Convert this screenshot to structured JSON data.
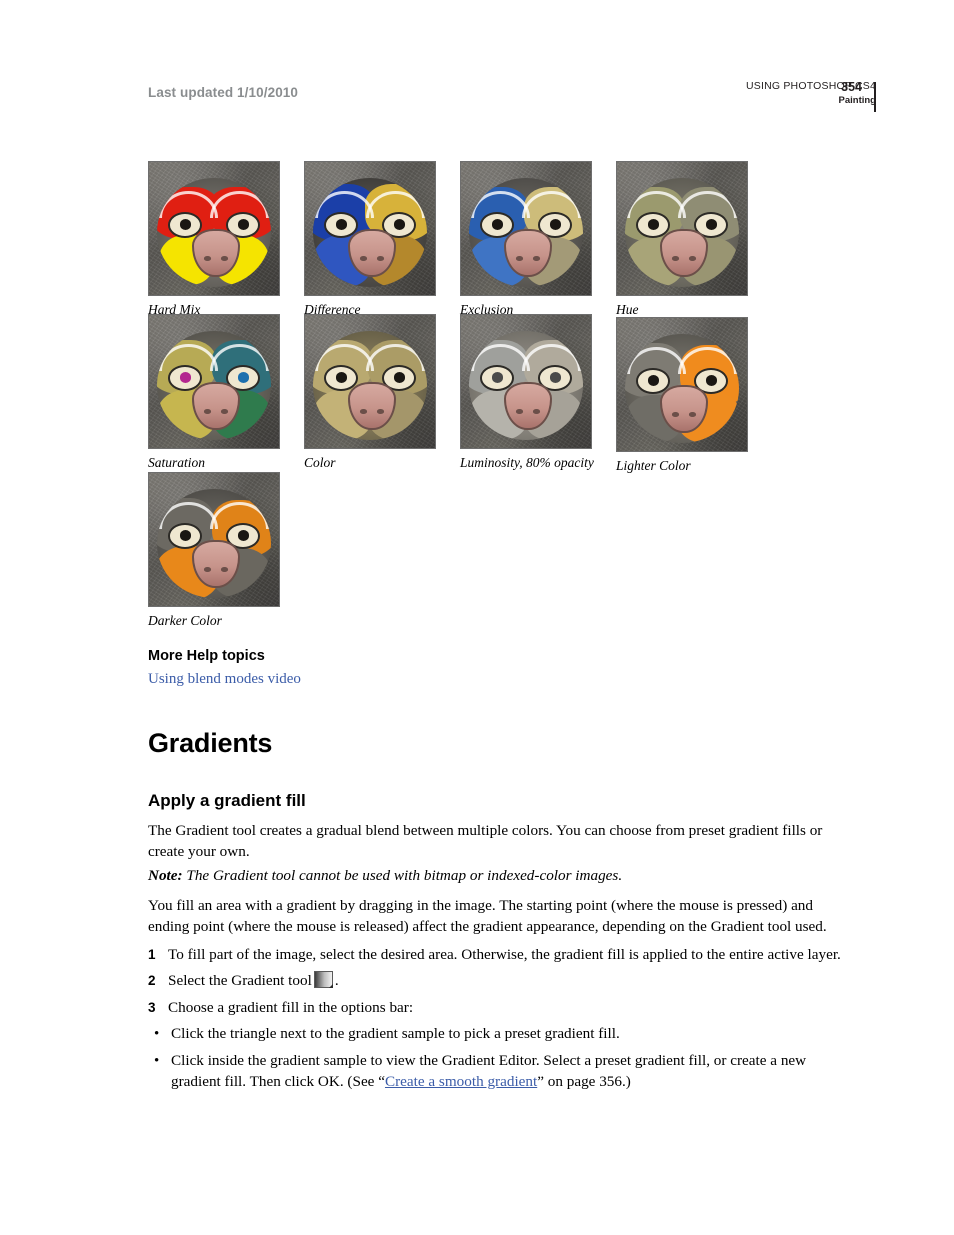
{
  "header": {
    "last_updated": "Last updated 1/10/2010",
    "doc_title": "USING PHOTOSHOP CS4",
    "section": "Painting",
    "page_number": "354"
  },
  "figures": [
    {
      "caption": "Hard Mix"
    },
    {
      "caption": "Difference"
    },
    {
      "caption": "Exclusion"
    },
    {
      "caption": "Hue"
    },
    {
      "caption": "Saturation"
    },
    {
      "caption": "Color"
    },
    {
      "caption": "Luminosity, 80% opacity"
    },
    {
      "caption": "Lighter Color"
    },
    {
      "caption": "Darker Color"
    }
  ],
  "more_help": {
    "heading": "More Help topics",
    "link": "Using blend modes video"
  },
  "gradients": {
    "h1": "Gradients",
    "h2": "Apply a gradient fill",
    "intro": "The Gradient tool creates a gradual blend between multiple colors. You can choose from preset gradient fills or create your own.",
    "note_label": "Note:",
    "note_text": "The Gradient tool cannot be used with bitmap or indexed-color images.",
    "paragraph2": "You fill an area with a gradient by dragging in the image. The starting point (where the mouse is pressed) and ending point (where the mouse is released) affect the gradient appearance, depending on the Gradient tool used.",
    "steps": [
      {
        "num": "1",
        "text": "To fill part of the image, select the desired area. Otherwise, the gradient fill is applied to the entire active layer."
      },
      {
        "num": "2",
        "text_before": "Select the Gradient tool",
        "icon": "gradient-tool-icon",
        "text_after": "."
      },
      {
        "num": "3",
        "text": "Choose a gradient fill in the options bar:"
      }
    ],
    "bullets": [
      {
        "bullet": "•",
        "text": "Click the triangle next to the gradient sample to pick a preset gradient fill."
      },
      {
        "bullet": "•",
        "text_before": "Click inside the gradient sample to view the Gradient Editor. Select a preset gradient fill, or create a new gradient fill. Then click OK. (See “",
        "link": "Create a smooth gradient",
        "text_after": "” on page 356.)"
      }
    ]
  }
}
